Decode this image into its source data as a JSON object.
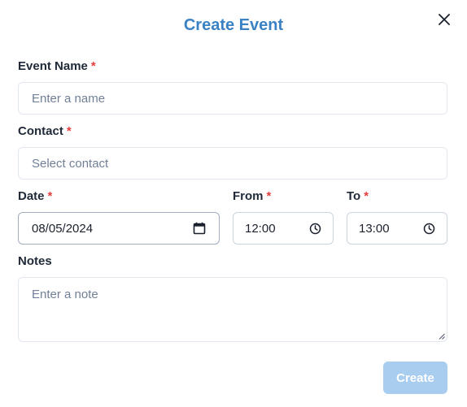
{
  "dialog": {
    "title": "Create Event",
    "close_icon": "close-icon"
  },
  "form": {
    "event_name": {
      "label": "Event Name",
      "required_mark": "*",
      "placeholder": "Enter a name",
      "value": ""
    },
    "contact": {
      "label": "Contact",
      "required_mark": "*",
      "placeholder": "Select contact",
      "value": ""
    },
    "date": {
      "label": "Date",
      "required_mark": "*",
      "value": "08/05/2024",
      "icon": "calendar-icon"
    },
    "from": {
      "label": "From",
      "required_mark": "*",
      "value": "12:00",
      "icon": "clock-icon"
    },
    "to": {
      "label": "To",
      "required_mark": "*",
      "value": "13:00",
      "icon": "clock-icon"
    },
    "notes": {
      "label": "Notes",
      "placeholder": "Enter a note",
      "value": ""
    }
  },
  "actions": {
    "create_label": "Create",
    "create_disabled": true
  },
  "colors": {
    "title": "#3a82c4",
    "required": "#e53e3e",
    "create_button_disabled": "#a9cdef",
    "border": "#e2e8f0"
  }
}
